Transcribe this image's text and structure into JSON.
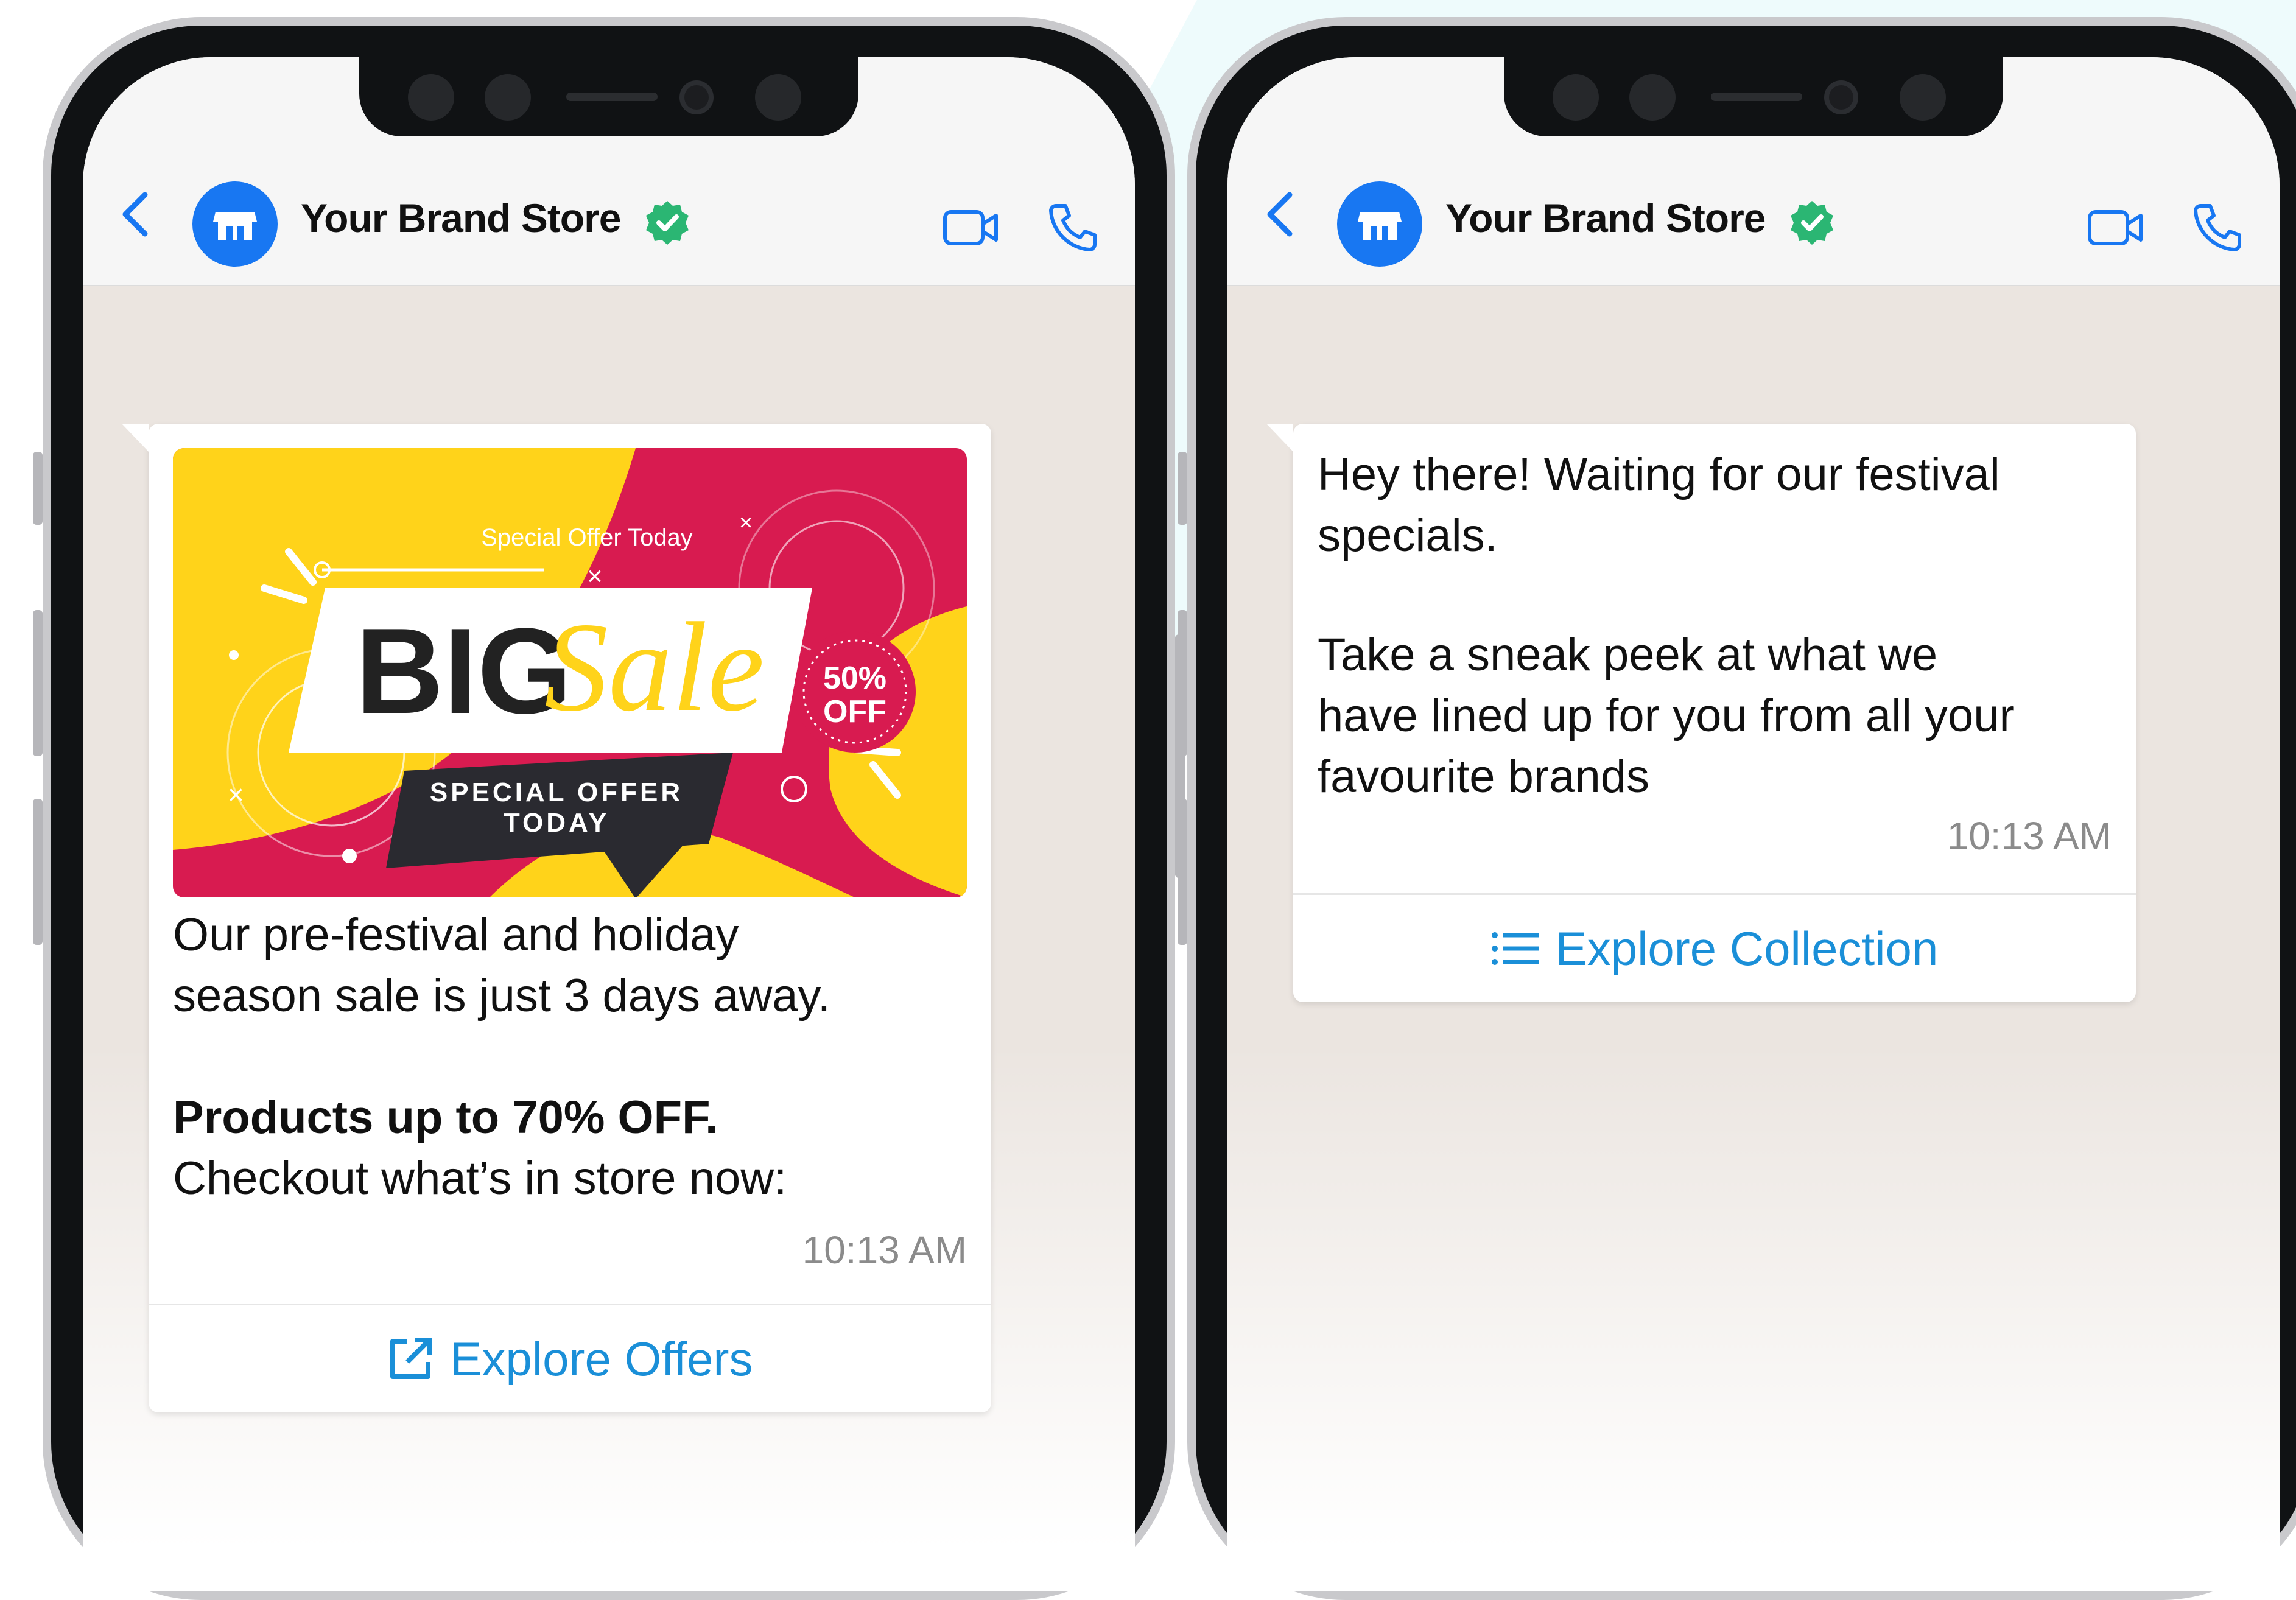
{
  "screens": [
    {
      "header": {
        "store_name": "Your Brand Store"
      },
      "banner": {
        "top_text": "Special Offer Today",
        "big": "BIG",
        "script": "Sale",
        "badge_percent": "50%",
        "badge_off": "OFF",
        "ribbon_line1": "SPECIAL OFFER",
        "ribbon_line2": "TODAY"
      },
      "message": {
        "text1": "Our pre-festival and  holiday\nseason sale is just 3 days away.",
        "bold": "Products up to 70% OFF.",
        "text2": "Checkout what’s in store now:",
        "time": "10:13 AM"
      },
      "action": {
        "label": "Explore Offers",
        "icon": "external-link-icon"
      }
    },
    {
      "header": {
        "store_name": "Your Brand Store"
      },
      "message": {
        "text1": "Hey there! Waiting for our festival\nspecials.",
        "text2": "Take a sneak peek at what we\nhave lined up for you from all your\nfavourite brands",
        "time": "10:13 AM"
      },
      "action": {
        "label": "Explore Collection",
        "icon": "list-icon"
      }
    }
  ],
  "colors": {
    "accent": "#1a8fd8",
    "avatar": "#1877f2",
    "verified": "#2bb673",
    "banner_red": "#d81b50",
    "banner_yellow": "#ffd31a"
  }
}
